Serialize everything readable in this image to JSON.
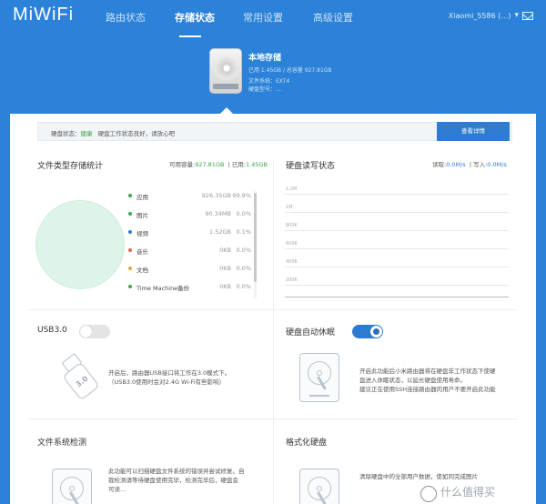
{
  "header": {
    "logo": "MiWiFi",
    "nav": [
      {
        "label": "路由状态",
        "active": false
      },
      {
        "label": "存储状态",
        "active": true
      },
      {
        "label": "常用设置",
        "active": false
      },
      {
        "label": "高级设置",
        "active": false
      }
    ],
    "user_label": "Xiaomi_5586 (…)"
  },
  "hero": {
    "title": "本地存储",
    "lines": [
      "已用 1.45GB / 总容量 927.81GB",
      "文件系统：EXT4",
      "硬盘型号：…"
    ]
  },
  "status": {
    "prefix": "硬盘状态：",
    "state": "健康",
    "message": "硬盘工作状态良好，请放心吧",
    "detail_button": "查看详情"
  },
  "file_types": {
    "title": "文件类型存储统计",
    "free_label": "可用容量:",
    "free_value": "927.81GB",
    "used_label": "已用:",
    "used_value": "1.45GB",
    "items": [
      {
        "name": "应用",
        "size": "926.35GB",
        "pct": "99.9%",
        "color": "#3aa64a"
      },
      {
        "name": "图片",
        "size": "90.34MB",
        "pct": "0.0%",
        "color": "#3aa64a"
      },
      {
        "name": "视频",
        "size": "1.52GB",
        "pct": "0.1%",
        "color": "#2e7cd1"
      },
      {
        "name": "音乐",
        "size": "0KB",
        "pct": "0.0%",
        "color": "#e0645a"
      },
      {
        "name": "文档",
        "size": "0KB",
        "pct": "0.0%",
        "color": "#e8a33d"
      },
      {
        "name": "Time Machine备份",
        "size": "0KB",
        "pct": "0.0%",
        "color": "#3aa64a"
      }
    ]
  },
  "rw": {
    "title": "硬盘读写状态",
    "read_label": "读取:",
    "read_value": "0.0M/s",
    "write_label": "写入:",
    "write_value": "0.0M/s",
    "ticks": [
      "1.2M",
      "1M",
      "800K",
      "600K",
      "400K",
      "200K"
    ]
  },
  "usb": {
    "title": "USB3.0",
    "enabled": false,
    "desc_line1": "开启后，路由器USB接口将工作在3.0模式下。",
    "desc_line2": "（USB3.0使用时会对2.4G Wi-Fi有些影响）",
    "icon_label": "3.0"
  },
  "sleep": {
    "title": "硬盘自动休眠",
    "enabled": true,
    "desc_line1": "开启此功能后小米路由器将在硬盘非工作状态下使硬",
    "desc_line2": "盘进入休眠状态，以延长硬盘使用寿命。",
    "desc_line3": "建议正在使用SSH连接路由器的用户不要开启此功能"
  },
  "fscheck": {
    "title": "文件系统检测",
    "desc_line1": "此功能可以扫描硬盘文件系统的错误并尝试修复。自",
    "desc_line2": "我检测请等待硬盘使用完毕，检测完毕后，硬盘会",
    "desc_line3": "可读..."
  },
  "format": {
    "title": "格式化硬盘",
    "desc_line1": "清除硬盘中的全部用户数据，使如同完成图片"
  },
  "watermark": {
    "text": "什么值得买"
  }
}
